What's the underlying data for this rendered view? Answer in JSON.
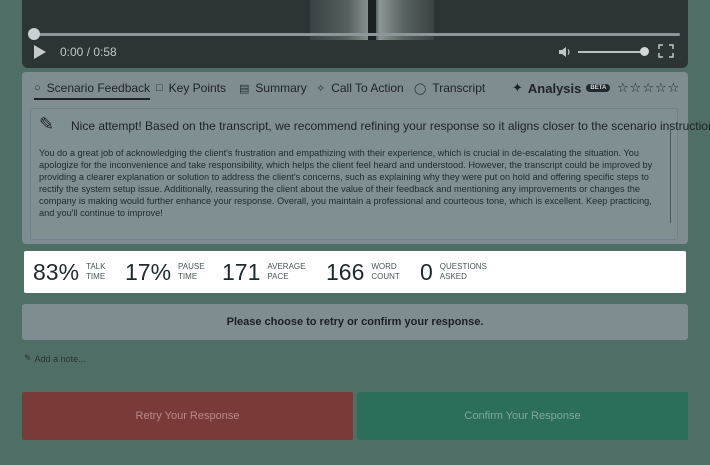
{
  "video": {
    "time_current": "0:00",
    "time_total": "0:58",
    "play_icon": "play-icon",
    "volume_icon": "speaker-icon",
    "fullscreen_icon": "fullscreen-icon"
  },
  "tabs": [
    {
      "label": "Scenario Feedback",
      "icon": "bulb-icon",
      "active": true
    },
    {
      "label": "Key Points",
      "icon": "bookmark-icon",
      "active": false
    },
    {
      "label": "Summary",
      "icon": "document-icon",
      "active": false
    },
    {
      "label": "Call To Action",
      "icon": "sparkle-icon",
      "active": false
    },
    {
      "label": "Transcript",
      "icon": "chat-icon",
      "active": false
    }
  ],
  "analysis": {
    "label": "Analysis",
    "badge": "BETA",
    "rating": 0,
    "max_rating": 5
  },
  "feedback": {
    "headline": "Nice attempt! Based on the transcript, we recommend refining your response so it aligns closer to the scenario instructions.",
    "body": "You do a great job of acknowledging the client's frustration and empathizing with their experience, which is crucial in de-escalating the situation. You apologize for the inconvenience and take responsibility, which helps the client feel heard and understood. However, the transcript could be improved by providing a clearer explanation or solution to address the client's concerns, such as explaining why they were put on hold and offering specific steps to rectify the system setup issue. Additionally, reassuring the client about the value of their feedback and mentioning any improvements or changes the company is making would further enhance your response. Overall, you maintain a professional and courteous tone, which is excellent. Keep practicing, and you'll continue to improve!"
  },
  "stats": [
    {
      "value": "83%",
      "label_line1": "TALK",
      "label_line2": "TIME"
    },
    {
      "value": "17%",
      "label_line1": "PAUSE",
      "label_line2": "TIME"
    },
    {
      "value": "171",
      "label_line1": "AVERAGE",
      "label_line2": "PACE"
    },
    {
      "value": "166",
      "label_line1": "WORD",
      "label_line2": "COUNT"
    },
    {
      "value": "0",
      "label_line1": "QUESTIONS",
      "label_line2": "ASKED"
    }
  ],
  "prompt": "Please choose to retry or confirm your response.",
  "add_note": "Add a note...",
  "buttons": {
    "retry": "Retry Your Response",
    "confirm": "Confirm Your Response"
  },
  "colors": {
    "overlay_bg": "#4f6f66",
    "retry": "#7a3a37",
    "confirm": "#2b6e59"
  }
}
